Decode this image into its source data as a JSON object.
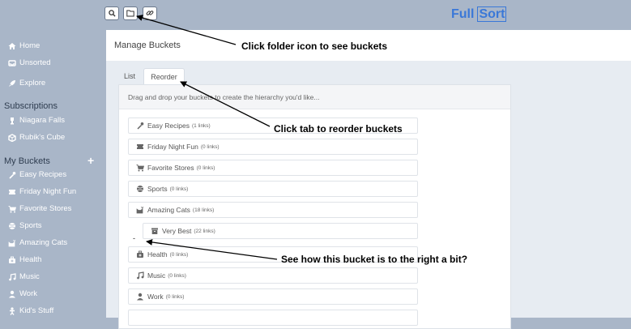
{
  "logo": {
    "part1": "Full",
    "part2": "Sort"
  },
  "toolbar": {
    "search_icon": "search-icon",
    "folder_icon": "folder-icon",
    "link_icon": "link-icon"
  },
  "sidebar": {
    "nav": [
      {
        "label": "Home",
        "icon": "home-icon"
      },
      {
        "label": "Unsorted",
        "icon": "inbox-icon"
      },
      {
        "label": "Explore",
        "icon": "rocket-icon"
      }
    ],
    "subscriptions_heading": "Subscriptions",
    "subscriptions": [
      {
        "label": "Niagara Falls",
        "icon": "faucet-icon"
      },
      {
        "label": "Rubik's Cube",
        "icon": "cube-icon"
      }
    ],
    "buckets_heading": "My Buckets",
    "add_icon": "+",
    "buckets": [
      {
        "label": "Easy Recipes",
        "icon": "utensils-icon"
      },
      {
        "label": "Friday Night Fun",
        "icon": "ticket-icon"
      },
      {
        "label": "Favorite Stores",
        "icon": "cart-icon"
      },
      {
        "label": "Sports",
        "icon": "ball-icon"
      },
      {
        "label": "Amazing Cats",
        "icon": "cat-icon"
      },
      {
        "label": "Health",
        "icon": "medkit-icon"
      },
      {
        "label": "Music",
        "icon": "music-icon"
      },
      {
        "label": "Work",
        "icon": "user-icon"
      },
      {
        "label": "Kid's Stuff",
        "icon": "child-icon"
      }
    ]
  },
  "main": {
    "title": "Manage Buckets",
    "tabs": [
      {
        "label": "List"
      },
      {
        "label": "Reorder"
      }
    ],
    "instruction": "Drag and drop your buckets to create the hierarchy you'd like...",
    "collapse_marker": "-",
    "buckets": [
      {
        "name": "Easy Recipes",
        "count": "(1 links)",
        "icon": "utensils-icon"
      },
      {
        "name": "Friday Night Fun",
        "count": "(0 links)",
        "icon": "ticket-icon"
      },
      {
        "name": "Favorite Stores",
        "count": "(0 links)",
        "icon": "cart-icon"
      },
      {
        "name": "Sports",
        "count": "(0 links)",
        "icon": "ball-icon"
      },
      {
        "name": "Amazing Cats",
        "count": "(18 links)",
        "icon": "cat-icon"
      },
      {
        "name": "Very Best",
        "count": "(22 links)",
        "icon": "box-icon"
      },
      {
        "name": "Health",
        "count": "(0 links)",
        "icon": "medkit-icon"
      },
      {
        "name": "Music",
        "count": "(0 links)",
        "icon": "music-icon"
      },
      {
        "name": "Work",
        "count": "(0 links)",
        "icon": "user-icon"
      }
    ]
  },
  "annotations": {
    "folder": "Click folder icon to see buckets",
    "tab": "Click tab to reorder buckets",
    "indent": "See how this bucket is to the right a bit?"
  }
}
